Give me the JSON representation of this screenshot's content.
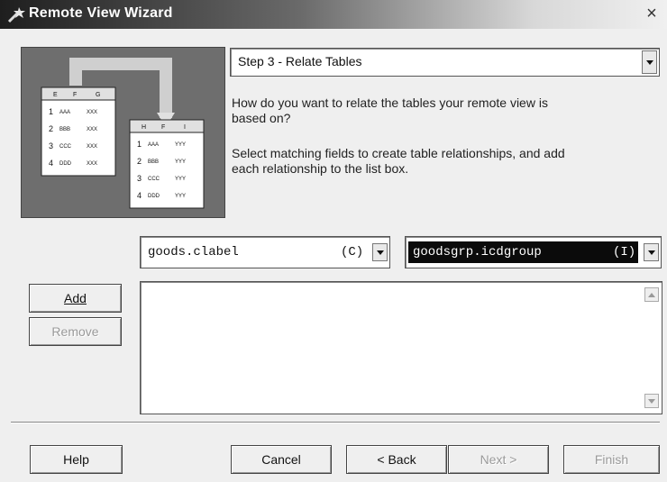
{
  "window": {
    "title": "Remote View Wizard",
    "close_glyph": "×"
  },
  "step_combo": {
    "value": "Step 3 - Relate Tables"
  },
  "description": {
    "line1": "How do you want to relate the tables your remote view is",
    "line2": "based on?",
    "line3": "Select matching fields to create table relationships, and add",
    "line4": "each relationship to the list box."
  },
  "illustration": {
    "left_table": {
      "headers": [
        "E",
        "F",
        "G"
      ],
      "rows": [
        [
          "1",
          "AAA",
          "XXX"
        ],
        [
          "2",
          "BBB",
          "XXX"
        ],
        [
          "3",
          "CCC",
          "XXX"
        ],
        [
          "4",
          "DDD",
          "XXX"
        ]
      ]
    },
    "right_table": {
      "headers": [
        "H",
        "F",
        "I"
      ],
      "rows": [
        [
          "1",
          "AAA",
          "YYY"
        ],
        [
          "2",
          "BBB",
          "YYY"
        ],
        [
          "3",
          "CCC",
          "YYY"
        ],
        [
          "4",
          "DDD",
          "YYY"
        ]
      ]
    }
  },
  "left_field": {
    "name": "goods.clabel",
    "type": "(C)"
  },
  "right_field": {
    "name": "goodsgrp.icdgroup",
    "type": "(I)"
  },
  "buttons": {
    "add": "Add",
    "remove": "Remove",
    "help": "Help",
    "cancel": "Cancel",
    "back": "< Back",
    "next": "Next >",
    "finish": "Finish"
  }
}
